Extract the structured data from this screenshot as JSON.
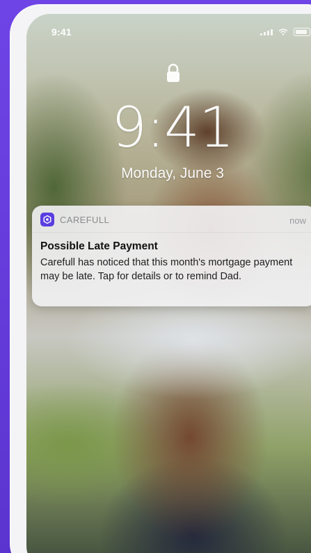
{
  "status_bar": {
    "time": "9:41",
    "icons": [
      "signal-icon",
      "wifi-icon",
      "battery-icon"
    ]
  },
  "lock_screen": {
    "lock_icon": "lock-icon",
    "time": "9:41",
    "date": "Monday, June 3"
  },
  "notification": {
    "app_icon": "carefull-app-icon",
    "app_name": "CAREFULL",
    "time": "now",
    "title": "Possible Late Payment",
    "body": "Carefull has noticed that this month's mortgage payment may be late. Tap for details or to remind Dad."
  },
  "colors": {
    "background": "#6a3fe0",
    "app_icon": "#5a3ee0"
  }
}
